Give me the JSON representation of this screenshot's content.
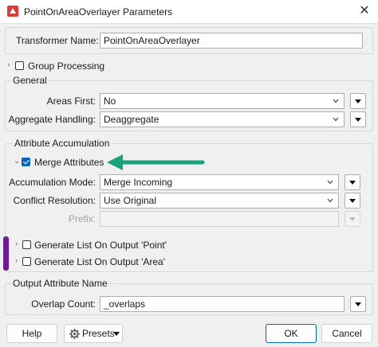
{
  "window": {
    "title": "PointOnAreaOverlayer Parameters",
    "close_glyph": "✕"
  },
  "transformer": {
    "label": "Transformer Name:",
    "value": "PointOnAreaOverlayer"
  },
  "group_processing": {
    "label": "Group Processing",
    "checked": false
  },
  "general": {
    "title": "General",
    "areas_first": {
      "label": "Areas First:",
      "value": "No"
    },
    "aggregate_handling": {
      "label": "Aggregate Handling:",
      "value": "Deaggregate"
    }
  },
  "attribute_accumulation": {
    "title": "Attribute Accumulation",
    "merge_attributes": {
      "label": "Merge Attributes",
      "checked": true
    },
    "accumulation_mode": {
      "label": "Accumulation Mode:",
      "value": "Merge Incoming"
    },
    "conflict_resolution": {
      "label": "Conflict Resolution:",
      "value": "Use Original"
    },
    "prefix": {
      "label": "Prefix:",
      "value": ""
    },
    "generate_list_point": {
      "label": "Generate List On Output 'Point'",
      "checked": false
    },
    "generate_list_area": {
      "label": "Generate List On Output 'Area'",
      "checked": false
    }
  },
  "output_attribute": {
    "title": "Output Attribute Name",
    "overlap_count": {
      "label": "Overlap Count:",
      "value": "_overlaps"
    }
  },
  "footer": {
    "help": "Help",
    "presets": "Presets",
    "ok": "OK",
    "cancel": "Cancel"
  },
  "icons": {
    "app": "fme-transformer-icon",
    "presets": "gear-icon",
    "annotation_arrow": "arrow-left-icon"
  },
  "colors": {
    "accent": "#0067c0",
    "annotation_arrow": "#1aa37a",
    "annotation_bar": "#6a1b9a"
  }
}
